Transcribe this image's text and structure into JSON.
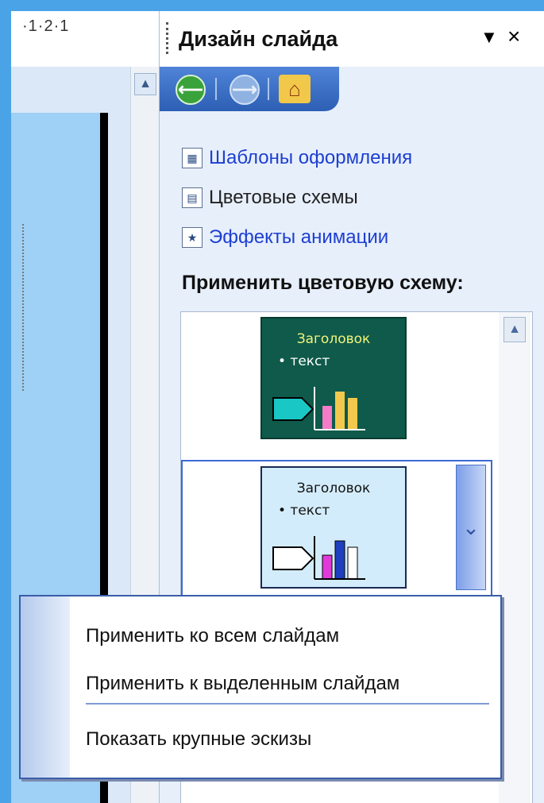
{
  "ruler": {
    "text": "·1·2·1"
  },
  "pane": {
    "title": "Дизайн слайда",
    "menu_glyph": "▼",
    "close_glyph": "×"
  },
  "nav": {
    "back": "⟵",
    "forward": "⟶",
    "home": "⌂"
  },
  "links": [
    {
      "label": "Шаблоны оформления",
      "icon": "design-templates-icon"
    },
    {
      "label": "Цветовые схемы",
      "icon": "color-schemes-icon"
    },
    {
      "label": "Эффекты анимации",
      "icon": "animation-effects-icon"
    }
  ],
  "section_title": "Применить цветовую схему:",
  "schemes": [
    {
      "title": "Заголовок",
      "bullet": "• текст",
      "background": "#0f5a4a"
    },
    {
      "title": "Заголовок",
      "bullet": "• текст",
      "background": "#d3ecfb"
    }
  ],
  "context_menu": {
    "items": [
      "Применить ко всем слайдам",
      "Применить к выделенным слайдам",
      "Показать крупные эскизы"
    ]
  },
  "colors": {
    "accent": "#3c6ad6",
    "link": "#1d3fd1",
    "background": "#4aa3e6"
  }
}
